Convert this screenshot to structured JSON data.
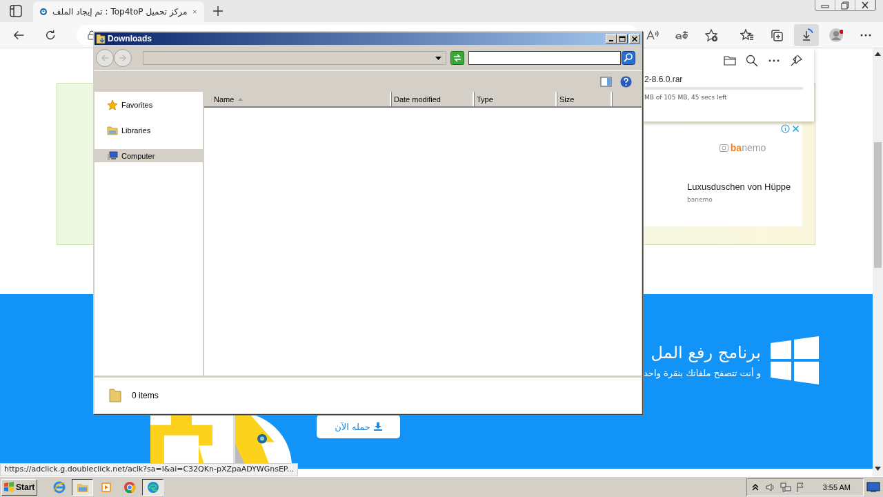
{
  "browser": {
    "tab": {
      "title": "مركز تحميل Top4toP : تم إيجاد الملف"
    },
    "toolbar_buttons": [
      {
        "kind": "read-aloud",
        "selected": false
      },
      {
        "kind": "translate",
        "selected": false
      },
      {
        "kind": "add-favorite",
        "selected": false
      },
      {
        "kind": "favorites",
        "selected": false
      },
      {
        "kind": "collections",
        "selected": false
      },
      {
        "kind": "downloads",
        "selected": true
      },
      {
        "kind": "profile",
        "selected": false
      },
      {
        "kind": "more",
        "selected": false
      }
    ],
    "downloads_flyout": {
      "file_name": "2-8.6.0.rar",
      "progress_text": "MB of 105 MB, 45 secs left"
    },
    "ad": {
      "logo_bold": "ba",
      "logo_rest": "nemo",
      "headline": "Luxusduschen von Hüppe",
      "advertiser": "banemo"
    },
    "banner": {
      "heading": "برنامج رفع المل",
      "subtitle": "و أنت تتصفح ملفاتك بنقرة واحد",
      "button": "حمله الآن"
    },
    "status_url": "https://adclick.g.doubleclick.net/aclk?sa=l&ai=C32QKn-pXZpaADYWGnsEP..."
  },
  "explorer": {
    "title": "Downloads",
    "nav_items": [
      {
        "kind": "favorites",
        "label": "Favorites",
        "selected": false
      },
      {
        "kind": "libraries",
        "label": "Libraries",
        "selected": false
      },
      {
        "kind": "computer",
        "label": "Computer",
        "selected": true
      }
    ],
    "columns": [
      {
        "label": "Name",
        "sorted": true
      },
      {
        "label": "Date modified",
        "sorted": false
      },
      {
        "label": "Type",
        "sorted": false
      },
      {
        "label": "Size",
        "sorted": false
      }
    ],
    "status": "0 items"
  },
  "taskbar": {
    "start": "Start",
    "items": [
      {
        "kind": "ie",
        "selected": false
      },
      {
        "kind": "explorer",
        "selected": true
      },
      {
        "kind": "media",
        "selected": false
      },
      {
        "kind": "chrome",
        "selected": false
      },
      {
        "kind": "edge",
        "selected": true
      }
    ],
    "clock": "3:55 AM"
  }
}
